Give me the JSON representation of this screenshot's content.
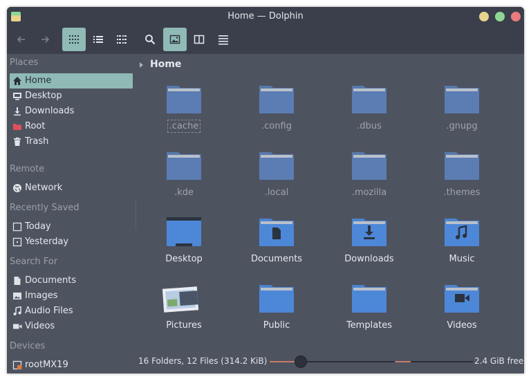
{
  "window": {
    "title": "Home — Dolphin"
  },
  "toolbar": {
    "buttons": [
      "back-icon",
      "forward-icon",
      "icons-view-icon",
      "details-view-icon",
      "compact-view-icon",
      "search-icon",
      "preview-icon",
      "split-icon",
      "menu-icon"
    ]
  },
  "sidebar": {
    "places": {
      "title": "Places",
      "items": [
        {
          "label": "Home",
          "icon": "home-icon"
        },
        {
          "label": "Desktop",
          "icon": "desktop-icon"
        },
        {
          "label": "Downloads",
          "icon": "download-icon"
        },
        {
          "label": "Root",
          "icon": "folder-red-icon"
        },
        {
          "label": "Trash",
          "icon": "trash-icon"
        }
      ]
    },
    "remote": {
      "title": "Remote",
      "items": [
        {
          "label": "Network",
          "icon": "network-icon"
        }
      ]
    },
    "recent": {
      "title": "Recently Saved",
      "items": [
        {
          "label": "Today",
          "icon": "calendar-icon"
        },
        {
          "label": "Yesterday",
          "icon": "calendar-icon"
        }
      ]
    },
    "search": {
      "title": "Search For",
      "items": [
        {
          "label": "Documents",
          "icon": "document-icon"
        },
        {
          "label": "Images",
          "icon": "image-icon"
        },
        {
          "label": "Audio Files",
          "icon": "music-icon"
        },
        {
          "label": "Videos",
          "icon": "video-icon"
        }
      ]
    },
    "devices": {
      "title": "Devices",
      "items": [
        {
          "label": "rootMX19",
          "icon": "drive-icon"
        }
      ]
    }
  },
  "breadcrumb": {
    "current": "Home"
  },
  "files": [
    {
      "name": ".cache"
    },
    {
      "name": ".config"
    },
    {
      "name": ".dbus"
    },
    {
      "name": ".gnupg"
    },
    {
      "name": ".kde"
    },
    {
      "name": ".local"
    },
    {
      "name": ".mozilla"
    },
    {
      "name": ".themes"
    },
    {
      "name": "Desktop"
    },
    {
      "name": "Documents"
    },
    {
      "name": "Downloads"
    },
    {
      "name": "Music"
    },
    {
      "name": "Pictures"
    },
    {
      "name": "Public"
    },
    {
      "name": "Templates"
    },
    {
      "name": "Videos"
    }
  ],
  "status": {
    "summary": "16 Folders, 12 Files (314.2 KiB)",
    "free_space": "2.4 GiB free",
    "zoom_level": 0.25,
    "disk_used_fraction": 0.2
  },
  "colors": {
    "accent": "#8fbab5",
    "folder_hidden": "#5b7db4",
    "folder_normal": "#4d88d8",
    "folder_tab": "#b9c0ca",
    "root_red": "#e0505a"
  }
}
